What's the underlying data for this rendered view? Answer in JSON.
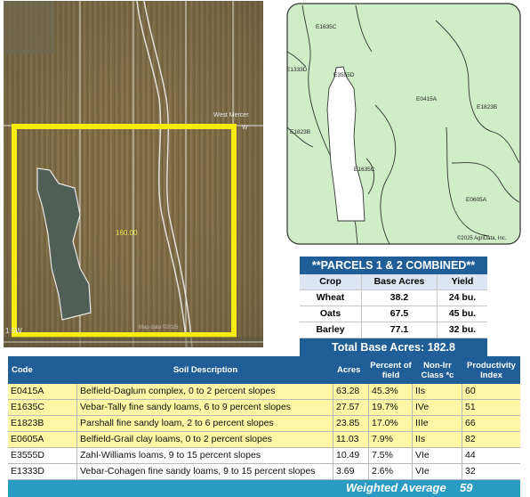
{
  "aerial": {
    "road_label": "West Mercer",
    "road_label_2": "W",
    "acres_label": "160.00",
    "corner_label": "1 5W",
    "watermark": "Map data ©2025"
  },
  "soil_map": {
    "labels": [
      "E1635C",
      "E1333D",
      "E3555D",
      "E0415A",
      "E1823B",
      "E1823B",
      "E1635C",
      "E0605A"
    ],
    "copyright": "©2025 AgriData, Inc."
  },
  "crop_table": {
    "title": "**PARCELS 1 & 2 COMBINED**",
    "headers": [
      "Crop",
      "Base Acres",
      "Yield"
    ],
    "rows": [
      [
        "Wheat",
        "38.2",
        "24 bu."
      ],
      [
        "Oats",
        "67.5",
        "45 bu."
      ],
      [
        "Barley",
        "77.1",
        "32 bu."
      ]
    ],
    "total": "Total Base Acres:  182.8"
  },
  "soil_table": {
    "headers": [
      "Code",
      "Soil Description",
      "Acres",
      "Percent of field",
      "Non-Irr Class *c",
      "Productivity Index"
    ],
    "rows": [
      {
        "code": "E0415A",
        "desc": "Belfield-Daglum complex, 0 to 2 percent slopes",
        "acres": "63.28",
        "pct": "45.3%",
        "cls": "IIs",
        "pi": "60",
        "highlight": true
      },
      {
        "code": "E1635C",
        "desc": "Vebar-Tally fine sandy loams, 6 to 9 percent slopes",
        "acres": "27.57",
        "pct": "19.7%",
        "cls": "IVe",
        "pi": "51",
        "highlight": true
      },
      {
        "code": "E1823B",
        "desc": "Parshall fine sandy loam, 2 to 6 percent slopes",
        "acres": "23.85",
        "pct": "17.0%",
        "cls": "IIIe",
        "pi": "66",
        "highlight": true
      },
      {
        "code": "E0605A",
        "desc": "Belfield-Grail clay loams, 0 to 2 percent slopes",
        "acres": "11.03",
        "pct": "7.9%",
        "cls": "IIs",
        "pi": "82",
        "highlight": true
      },
      {
        "code": "E3555D",
        "desc": "Zahl-Williams loams, 9 to 15 percent slopes",
        "acres": "10.49",
        "pct": "7.5%",
        "cls": "VIe",
        "pi": "44",
        "highlight": false
      },
      {
        "code": "E1333D",
        "desc": "Vebar-Cohagen fine sandy loams, 9 to 15 percent slopes",
        "acres": "3.69",
        "pct": "2.6%",
        "cls": "VIe",
        "pi": "32",
        "highlight": false
      }
    ],
    "footer_label": "Weighted Average",
    "footer_value": "59"
  }
}
